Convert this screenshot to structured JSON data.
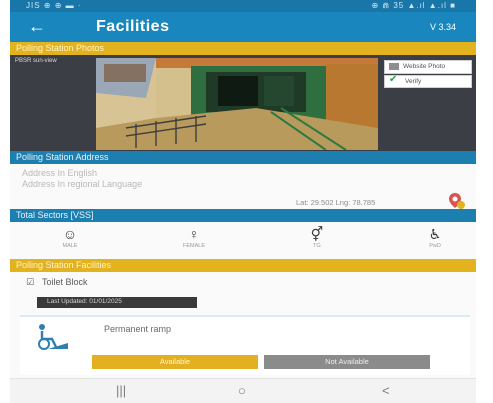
{
  "status_bar": {
    "left": "JIS ⊕ ⊕ ▬ ·",
    "right": "⊕ ⋒ 35 ▲.ıl ▲.ıl ■"
  },
  "app_bar": {
    "back_icon": "arrow-left-icon",
    "title": "Facilities",
    "version": "V 3.34"
  },
  "sections": {
    "photos_header": "Polling Station Photos",
    "address_header": "Polling Station Address",
    "voter_sectors_header": "Total Sectors [VSS]",
    "facilities_header": "Polling Station Facilities"
  },
  "photo": {
    "label": "PBSR sun-view",
    "website_button": "Website Photo",
    "verify_button": "Verify",
    "verify_icon": "checkmark-icon"
  },
  "address": {
    "line1": "Address In English",
    "line2": "Address In regional Language",
    "latlng": "Lat: 29.502  Lng: 78.785",
    "pin_icon": "location-pin-icon"
  },
  "voter_sectors": [
    {
      "icon": "male-voter-icon",
      "glyph": "☺",
      "caption": "MALE"
    },
    {
      "icon": "female-voter-icon",
      "glyph": "♀",
      "caption": "FEMALE"
    },
    {
      "icon": "third-gender-icon",
      "glyph": "⚥",
      "caption": "TG"
    },
    {
      "icon": "wheelchair-icon",
      "glyph": "♿",
      "caption": "PwD"
    }
  ],
  "facilities": {
    "checkbox_label": "Toilet Block",
    "checkbox_icon": "checkbox-checked-icon",
    "info_pill": "Last Updated: 01/01/2025",
    "ramp": {
      "label": "Permanent ramp",
      "icon": "wheelchair-ramp-icon",
      "available": "Available",
      "not_available": "Not Available"
    }
  },
  "nav_bar": {
    "recents": "|||",
    "home": "○",
    "back": "<"
  },
  "colors": {
    "primary_blue": "#1a86be",
    "accent_gold": "#e3b21f",
    "dark_band": "#3b3f45",
    "verify_green": "#25a244"
  }
}
